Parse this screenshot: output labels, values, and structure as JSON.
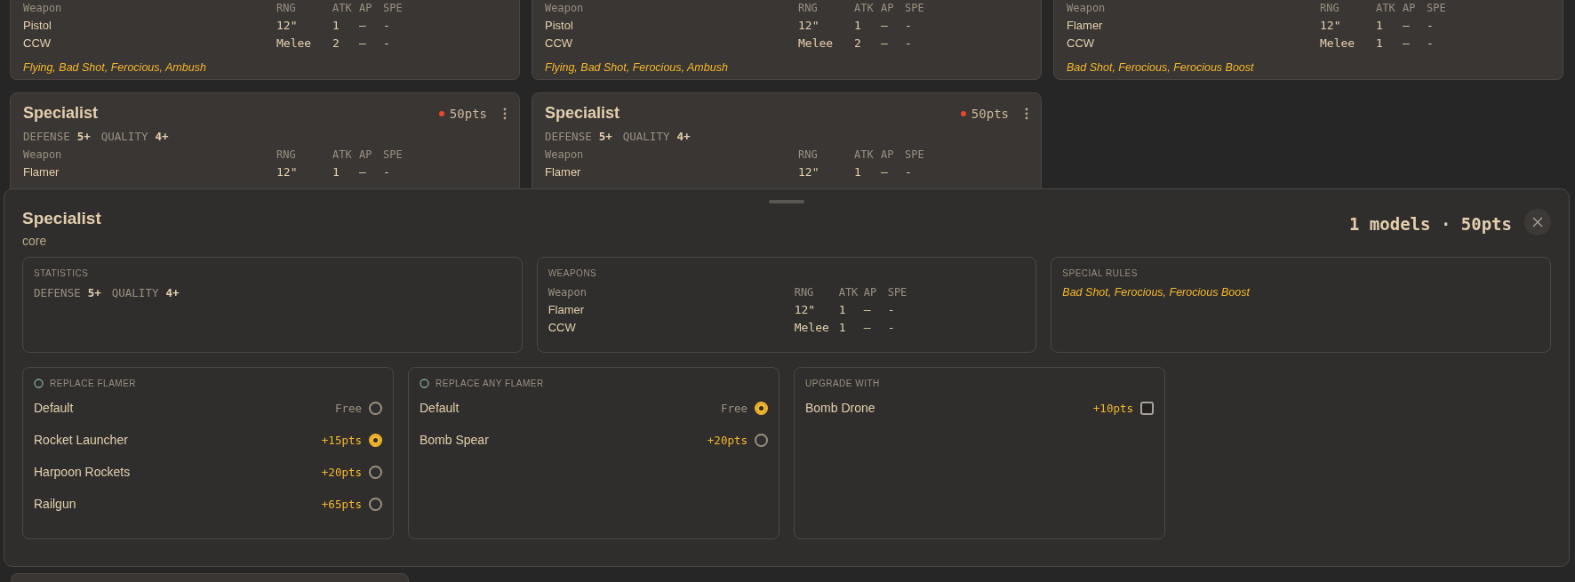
{
  "units": [
    {
      "columns": [
        "Weapon",
        "RNG",
        "ATK",
        "AP",
        "SPE"
      ],
      "weapons": [
        [
          "Pistol",
          "12\"",
          "1",
          "–",
          "-"
        ],
        [
          "CCW",
          "Melee",
          "2",
          "–",
          "-"
        ]
      ],
      "rules": "Flying, Bad Shot, Ferocious, Ambush"
    },
    {
      "columns": [
        "Weapon",
        "RNG",
        "ATK",
        "AP",
        "SPE"
      ],
      "weapons": [
        [
          "Pistol",
          "12\"",
          "1",
          "–",
          "-"
        ],
        [
          "CCW",
          "Melee",
          "2",
          "–",
          "-"
        ]
      ],
      "rules": "Flying, Bad Shot, Ferocious, Ambush"
    },
    {
      "columns": [
        "Weapon",
        "RNG",
        "ATK",
        "AP",
        "SPE"
      ],
      "weapons": [
        [
          "Flamer",
          "12\"",
          "1",
          "–",
          "-"
        ],
        [
          "CCW",
          "Melee",
          "1",
          "–",
          "-"
        ]
      ],
      "rules": "Bad Shot, Ferocious, Ferocious Boost"
    },
    {
      "name": "Specialist",
      "pts": "50pts",
      "stats": [
        {
          "label": "DEFENSE",
          "value": "5+"
        },
        {
          "label": "QUALITY",
          "value": "4+"
        }
      ],
      "columns": [
        "Weapon",
        "RNG",
        "ATK",
        "AP",
        "SPE"
      ],
      "weapons": [
        [
          "Flamer",
          "12\"",
          "1",
          "–",
          "-"
        ]
      ]
    },
    {
      "name": "Specialist",
      "pts": "50pts",
      "stats": [
        {
          "label": "DEFENSE",
          "value": "5+"
        },
        {
          "label": "QUALITY",
          "value": "4+"
        }
      ],
      "columns": [
        "Weapon",
        "RNG",
        "ATK",
        "AP",
        "SPE"
      ],
      "weapons": [
        [
          "Flamer",
          "12\"",
          "1",
          "–",
          "-"
        ]
      ]
    }
  ],
  "detail": {
    "title": "Specialist",
    "subtitle": "core",
    "summary": "1 models · 50pts",
    "statistics": {
      "heading": "STATISTICS",
      "stats": [
        {
          "label": "DEFENSE",
          "value": "5+"
        },
        {
          "label": "QUALITY",
          "value": "4+"
        }
      ]
    },
    "weapons": {
      "heading": "WEAPONS",
      "columns": [
        "Weapon",
        "RNG",
        "ATK",
        "AP",
        "SPE"
      ],
      "rows": [
        [
          "Flamer",
          "12\"",
          "1",
          "–",
          "-"
        ],
        [
          "CCW",
          "Melee",
          "1",
          "–",
          "-"
        ]
      ]
    },
    "special_rules": {
      "heading": "SPECIAL RULES",
      "text": "Bad Shot, Ferocious, Ferocious Boost"
    },
    "option_groups": [
      {
        "kind": "radio",
        "title": "REPLACE FLAMER",
        "items": [
          {
            "label": "Default",
            "cost": "Free",
            "free": true,
            "selected": false
          },
          {
            "label": "Rocket Launcher",
            "cost": "+15pts",
            "free": false,
            "selected": true
          },
          {
            "label": "Harpoon Rockets",
            "cost": "+20pts",
            "free": false,
            "selected": false
          },
          {
            "label": "Railgun",
            "cost": "+65pts",
            "free": false,
            "selected": false
          }
        ]
      },
      {
        "kind": "radio",
        "title": "REPLACE ANY FLAMER",
        "items": [
          {
            "label": "Default",
            "cost": "Free",
            "free": true,
            "selected": true
          },
          {
            "label": "Bomb Spear",
            "cost": "+20pts",
            "free": false,
            "selected": false
          }
        ]
      },
      {
        "kind": "checkbox",
        "title": "UPGRADE WITH",
        "items": [
          {
            "label": "Bomb Drone",
            "cost": "+10pts",
            "free": false,
            "checked": false
          }
        ]
      }
    ]
  }
}
